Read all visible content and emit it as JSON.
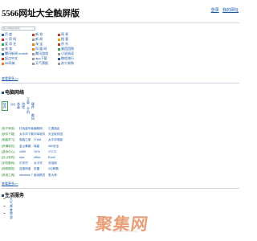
{
  "header": {
    "title": "5566网址大全触屏版",
    "links": [
      "登录",
      "我的网址"
    ]
  },
  "search": {
    "placeholder": "输入网站名搜索"
  },
  "nav": {
    "rows": [
      [
        {
          "label": "百 度",
          "color": "#2a5db0"
        },
        {
          "label": "新 浪",
          "color": "#c0392b"
        },
        {
          "label": "网 易",
          "color": "#c0392b"
        }
      ],
      [
        {
          "label": "人 民 网",
          "color": "#c0392b"
        },
        {
          "label": "新 闻",
          "color": "#999999"
        },
        {
          "label": "搜 狐",
          "color": "#e6a21a"
        }
      ],
      [
        {
          "label": "爱 奇 艺",
          "color": "#35a64b"
        },
        {
          "label": "淘 宝",
          "color": "#e67e22"
        },
        {
          "label": "京 东",
          "color": "#c0392b"
        }
      ],
      [
        {
          "label": "体 育",
          "color": "#999999"
        },
        {
          "label": "凤 凰 网",
          "color": "#e67e22"
        },
        {
          "label": "美团团购",
          "color": "#35a64b"
        }
      ],
      [
        {
          "label": "腾讯新闻 mobile",
          "color": "#2a5db0"
        },
        {
          "label": "腾讯游戏",
          "color": "#999999"
        },
        {
          "label": "小说阅读",
          "color": "#999999"
        }
      ],
      [
        {
          "label": "起点中文",
          "color": "#c0392b"
        },
        {
          "label": "app下载",
          "color": "#999999"
        },
        {
          "label": "携程旅行",
          "color": "#2a5db0"
        }
      ],
      [
        {
          "label": "58同城",
          "color": "#e67e22"
        },
        {
          "label": "天气预报",
          "color": "#999999"
        },
        {
          "label": "苏宁易购",
          "color": "#999999"
        }
      ]
    ],
    "more": "查看更多>>"
  },
  "computer_section": {
    "title": "电脑网络",
    "tabs": [
      "软件",
      "QQ",
      "杀毒",
      "游戏",
      "下载",
      "手机",
      "硬件",
      "数码"
    ],
    "rows": [
      {
        "cat": "[电子商务]",
        "links": [
          "红色盗号者",
          "编程网",
          "汇源酒店"
        ]
      },
      {
        "cat": "[软件下载]",
        "links": [
          "太平洋下载",
          "华军软件",
          "天空软件园"
        ]
      },
      {
        "cat": "[电脑学习]",
        "links": [
          "电脑之家",
          "IT168",
          "太平洋电脑"
        ]
      },
      {
        "cat": "[杀毒软件]",
        "links": [
          "金山毒霸",
          "瑞星",
          "360安全"
        ]
      },
      {
        "cat": "[游戏中心]",
        "links": [
          "4399",
          "7k7k",
          "17173"
        ]
      },
      {
        "cat": "[办公软件]",
        "links": [
          "wps",
          "office",
          "Excel"
        ]
      },
      {
        "cat": "[手机数码]",
        "links": [
          "中关村",
          "太平洋",
          "泡泡网"
        ]
      },
      {
        "cat": "[网络服务]",
        "links": [
          "百度网盘",
          "迅雷",
          "QQ邮箱"
        ]
      },
      {
        "cat": "[系统工具]",
        "links": [
          "windows 7",
          "驱动精灵",
          "鲁大师"
        ]
      }
    ],
    "more": "查看更多>>"
  },
  "life_section": {
    "title": "生活服务",
    "items": [
      "天气",
      "美食",
      "旅游"
    ]
  },
  "watermark": {
    "main": "聚集网",
    "sub": "WWW.JUJI.CC"
  }
}
